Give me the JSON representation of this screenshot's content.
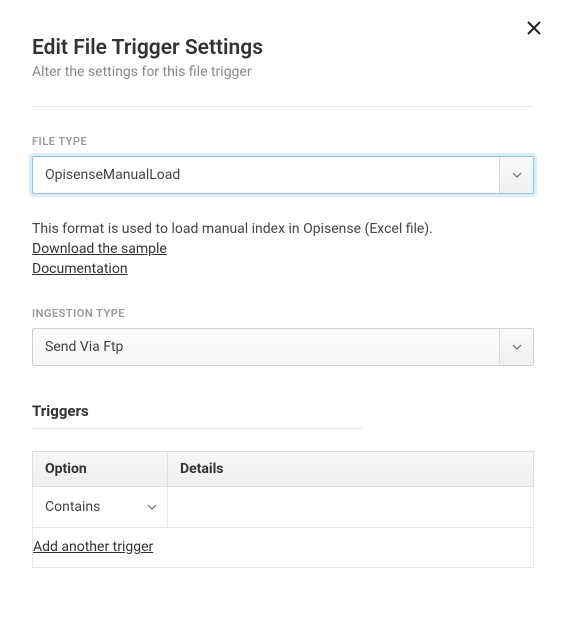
{
  "header": {
    "title": "Edit File Trigger Settings",
    "subtitle": "Alter the settings for this file trigger"
  },
  "file_type": {
    "label": "FILE TYPE",
    "value": "OpisenseManualLoad",
    "help": "This format is used to load manual index in Opisense (Excel file).",
    "download_link": "Download the sample",
    "doc_link": "Documentation"
  },
  "ingestion_type": {
    "label": "INGESTION TYPE",
    "value": "Send Via Ftp"
  },
  "triggers": {
    "heading": "Triggers",
    "columns": {
      "option": "Option",
      "details": "Details"
    },
    "rows": [
      {
        "option": "Contains",
        "details": ""
      }
    ],
    "add_link": "Add another trigger"
  }
}
